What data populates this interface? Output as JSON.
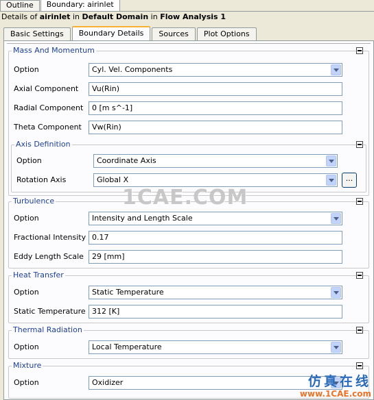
{
  "top_tabs": [
    {
      "label": "Outline"
    },
    {
      "label": "Boundary: airinlet"
    }
  ],
  "details": {
    "prefix": "Details of ",
    "object": "airinlet",
    "in1": " in ",
    "domain": "Default Domain",
    "in2": " in ",
    "analysis": "Flow Analysis 1"
  },
  "sub_tabs": [
    {
      "label": "Basic Settings"
    },
    {
      "label": "Boundary Details"
    },
    {
      "label": "Sources"
    },
    {
      "label": "Plot Options"
    }
  ],
  "mass_momentum": {
    "title": "Mass And Momentum",
    "option_label": "Option",
    "option_value": "Cyl. Vel. Components",
    "axial_label": "Axial Component",
    "axial_value": "Vu(Rin)",
    "radial_label": "Radial Component",
    "radial_value": "0 [m s^-1]",
    "theta_label": "Theta Component",
    "theta_value": "Vw(Rin)"
  },
  "axis_definition": {
    "title": "Axis Definition",
    "option_label": "Option",
    "option_value": "Coordinate Axis",
    "rotation_label": "Rotation Axis",
    "rotation_value": "Global X",
    "browse_label": "..."
  },
  "turbulence": {
    "title": "Turbulence",
    "option_label": "Option",
    "option_value": "Intensity and Length Scale",
    "intensity_label": "Fractional Intensity",
    "intensity_value": "0.17",
    "eddy_label": "Eddy Length Scale",
    "eddy_value": "29 [mm]"
  },
  "heat_transfer": {
    "title": "Heat Transfer",
    "option_label": "Option",
    "option_value": "Static Temperature",
    "temp_label": "Static Temperature",
    "temp_value": "312 [K]"
  },
  "thermal_radiation": {
    "title": "Thermal Radiation",
    "option_label": "Option",
    "option_value": "Local Temperature"
  },
  "mixture": {
    "title": "Mixture",
    "option_label": "Option",
    "option_value": "Oxidizer"
  },
  "watermark": {
    "text": "1CAE.COM",
    "logo_cn": "仿真在线",
    "logo_url": "www.1CAE.com"
  }
}
